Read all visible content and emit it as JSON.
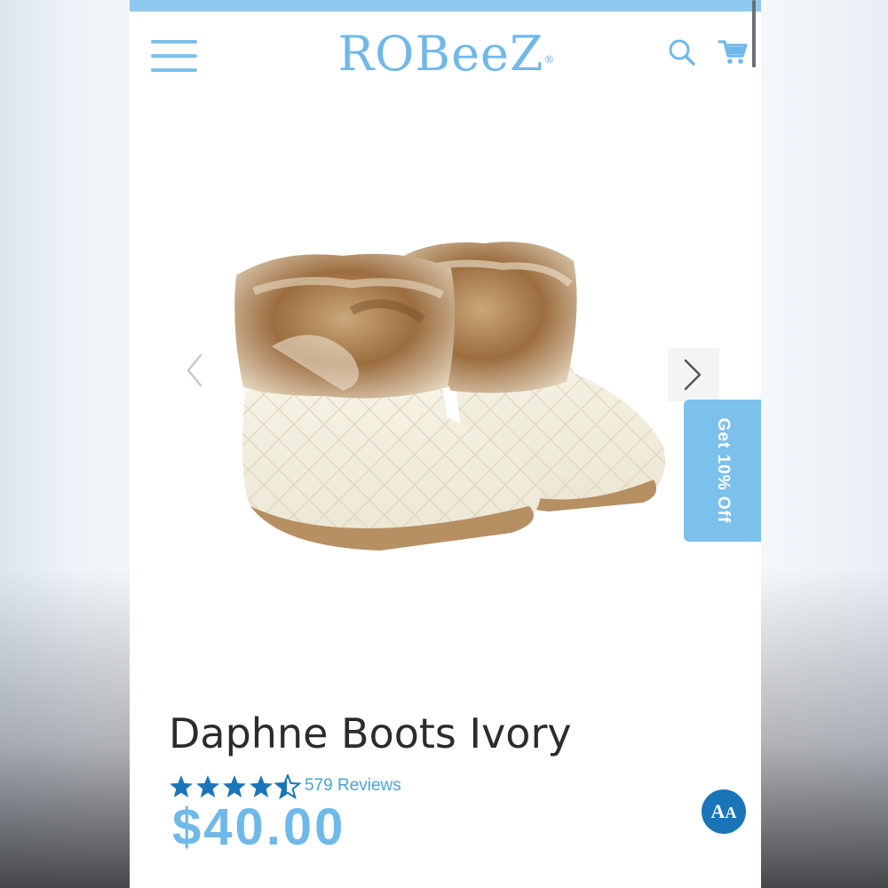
{
  "header": {
    "brand": "ROBeeZ",
    "brand_mark": "®",
    "menu_icon": "hamburger-menu-icon",
    "search_icon": "search-icon",
    "cart_icon": "shopping-cart-icon"
  },
  "gallery": {
    "image_alt": "Daphne Boots Ivory — knit booties with faux fur cuff",
    "prev_icon": "chevron-left-icon",
    "next_icon": "chevron-right-icon"
  },
  "promo": {
    "label": "Get 10% Off"
  },
  "product": {
    "title": "Daphne Boots Ivory",
    "rating": 4.5,
    "rating_max": 5,
    "reviews_label": "579 Reviews",
    "price": "$40.00"
  },
  "accessibility": {
    "label_large": "A",
    "label_small": "A",
    "icon": "accessibility-text-size-icon"
  },
  "colors": {
    "brand_blue": "#6fb8ea",
    "top_bar": "#8ec9f0",
    "star_blue": "#1a75b8",
    "link_blue": "#4aa3da",
    "title_text": "#2c2c2c"
  }
}
